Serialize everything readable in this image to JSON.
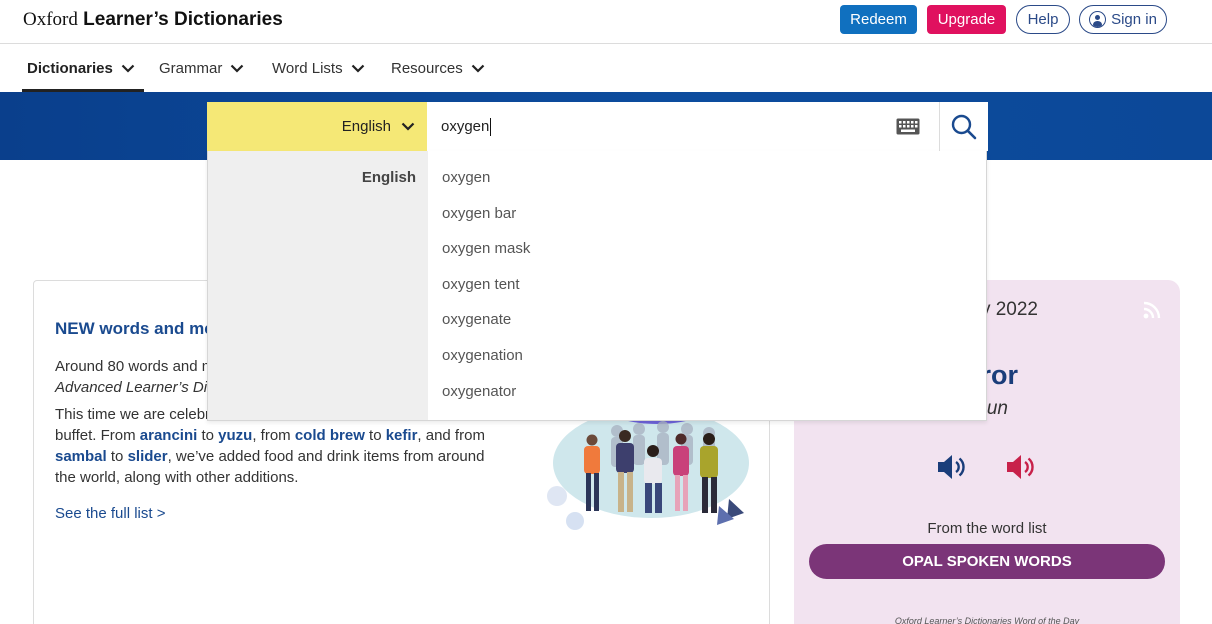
{
  "header": {
    "logo_part1": "Oxford",
    "logo_part2": "Learner’s Dictionaries",
    "redeem_label": "Redeem",
    "upgrade_label": "Upgrade",
    "help_label": "Help",
    "signin_label": "Sign in"
  },
  "nav": {
    "items": [
      {
        "label": "Dictionaries",
        "active": true
      },
      {
        "label": "Grammar"
      },
      {
        "label": "Word Lists"
      },
      {
        "label": "Resources"
      }
    ]
  },
  "search": {
    "language": "English",
    "query": "oxygen",
    "keyboard_icon": "keyboard-icon",
    "search_icon": "search-icon"
  },
  "autocomplete": {
    "language_label": "English",
    "suggestions": [
      "oxygen",
      "oxygen bar",
      "oxygen mask",
      "oxygen tent",
      "oxygenate",
      "oxygenation",
      "oxygenator"
    ]
  },
  "news_card": {
    "title": "NEW words and mea",
    "para1_line1": "Around 80 words and m",
    "para1_line2": "Advanced Learner’s Dicti",
    "para2_start": "This time we are celebr",
    "para2_line2a": "buffet. From ",
    "link_arancini": "arancini",
    "to1": " to ",
    "link_yuzu": "yuzu",
    "from_mid": ", from ",
    "link_coldbrew": "cold brew",
    "to2": " to ",
    "link_kefir": "kefir",
    "and_from": ", and from",
    "link_sambal": "sambal",
    "to3": " to ",
    "link_slider": "slider",
    "para2_end": ", we’ve added food and drink items from around the world, along with other additions.",
    "see_full": "See the full list >"
  },
  "word_of_day": {
    "date_fragment": "y 2022",
    "word_fragment": "ror",
    "pos_fragment": "un",
    "rss_icon": "rss-icon",
    "from_list_label": "From the word list",
    "opal_button": "OPAL SPOKEN WORDS",
    "footer": "Oxford Learner’s Dictionaries Word of the Day"
  },
  "colors": {
    "brand_blue": "#0c4c9e",
    "redeem": "#1070bf",
    "upgrade": "#e0115f",
    "language_yellow": "#f5e876",
    "link_blue": "#1a4a8f",
    "wotd_bg": "#f2e3f0",
    "opal_purple": "#7b3578",
    "speaker_uk": "#1a3d7a",
    "speaker_us": "#c8214a"
  }
}
